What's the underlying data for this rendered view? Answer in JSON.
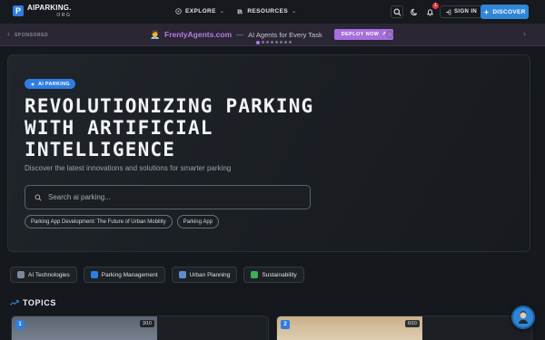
{
  "brand": {
    "name": "AIPARKING.",
    "sub": "ORG",
    "logo_letter": "P",
    "accent": "#2f7de1"
  },
  "nav": {
    "explore": "EXPLORE",
    "resources": "RESOURCES",
    "notification_count": "1",
    "signin": "SIGN IN",
    "discover": "DISCOVER"
  },
  "sponsor": {
    "label": "SPONSORED",
    "brand": "FrenlyAgents.com",
    "separator": "—",
    "tagline": "AI Agents for Every Task",
    "cta": "DEPLOY NOW",
    "accent": "#a86dde"
  },
  "hero": {
    "badge": "AI PARKING",
    "title": "REVOLUTIONIZING PARKING WITH ARTIFICIAL INTELLIGENCE",
    "subtitle": "Discover the latest innovations and solutions for smarter parking",
    "search_placeholder": "Search ai parking...",
    "chips": [
      "Parking App Development: The Future of Urban Mobility",
      "Parking App"
    ]
  },
  "categories": [
    {
      "label": "AI Technologies",
      "icon": "robot-icon",
      "color": "#7e8a99"
    },
    {
      "label": "Parking Management",
      "icon": "parking-icon",
      "color": "#2f7de1"
    },
    {
      "label": "Urban Planning",
      "icon": "city-icon",
      "color": "#5a8fc9"
    },
    {
      "label": "Sustainability",
      "icon": "leaf-icon",
      "color": "#3fae5a"
    }
  ],
  "topics": {
    "title": "TOPICS",
    "cards": [
      {
        "number": "1",
        "score": "3/10"
      },
      {
        "number": "2",
        "score": "6/10"
      }
    ]
  }
}
